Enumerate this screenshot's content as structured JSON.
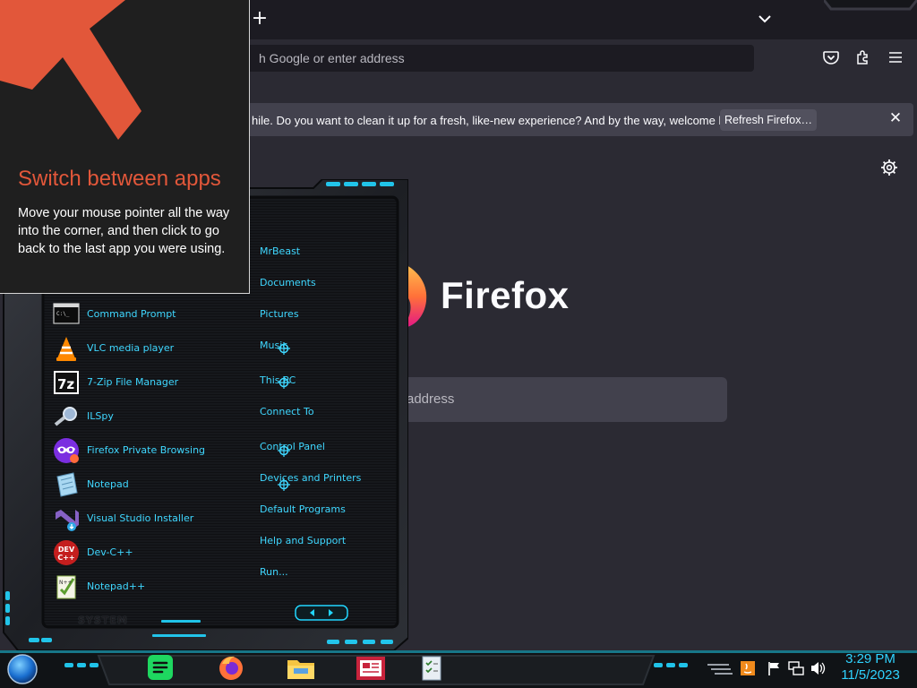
{
  "browser": {
    "address_placeholder": "h Google or enter address",
    "notification_text": "hile. Do you want to clean it up for a fresh, like-new experience? And by the way, welcome back!",
    "refresh_button": "Refresh Firefox…",
    "brand_name": "Firefox",
    "search_placeholder": "address",
    "icons": [
      "plus-icon",
      "chevron-down-icon",
      "pocket-icon",
      "extensions-icon",
      "menu-icon",
      "close-icon",
      "gear-icon",
      "firefox-logo-icon"
    ]
  },
  "tip": {
    "title": "Switch between apps",
    "body": "Move your mouse pointer all the way into the corner, and then click to go back to the last app you were using.",
    "accent_color": "#e2573a"
  },
  "start_menu": {
    "programs": [
      {
        "label": "Command Prompt",
        "icon": "command-prompt-icon",
        "pinned": false
      },
      {
        "label": "VLC media player",
        "icon": "vlc-icon",
        "pinned": true
      },
      {
        "label": "7-Zip File Manager",
        "icon": "7zip-icon",
        "pinned": true
      },
      {
        "label": "ILSpy",
        "icon": "ilspy-icon",
        "pinned": false
      },
      {
        "label": "Firefox Private Browsing",
        "icon": "firefox-private-icon",
        "pinned": true
      },
      {
        "label": "Notepad",
        "icon": "notepad-icon",
        "pinned": true
      },
      {
        "label": "Visual Studio Installer",
        "icon": "visual-studio-installer-icon",
        "pinned": false
      },
      {
        "label": "Dev-C++",
        "icon": "devcpp-icon",
        "pinned": false
      },
      {
        "label": "Notepad++",
        "icon": "notepadpp-icon",
        "pinned": false
      }
    ],
    "links": [
      "MrBeast",
      "Documents",
      "Pictures",
      "Music",
      "This PC",
      "Connect To",
      "Control Panel",
      "Devices and Printers",
      "Default Programs",
      "Help and Support",
      "Run..."
    ],
    "footer_label": "SYSTEM",
    "accent_color": "#3fd7ff"
  },
  "taskbar": {
    "apps": [
      "spotify-icon",
      "firefox-icon",
      "file-explorer-icon",
      "news-app-icon",
      "task-manager-icon"
    ],
    "tray_icons": [
      "java-update-icon",
      "action-center-flag-icon",
      "network-icon",
      "volume-icon"
    ],
    "time": "3:29 PM",
    "date": "11/5/2023",
    "clock_color": "#2fd3ff"
  }
}
